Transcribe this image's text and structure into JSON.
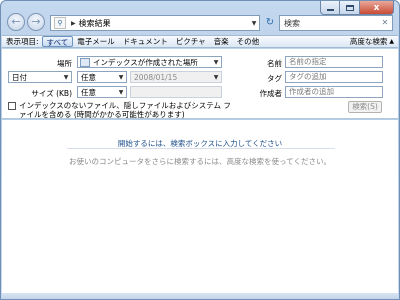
{
  "window": {
    "controls": {
      "close_glyph": "x"
    }
  },
  "nav": {
    "back_icon": "back-arrow-icon",
    "forward_icon": "forward-arrow-icon",
    "address": {
      "path": "検索結果"
    },
    "search": {
      "placeholder": "検索"
    }
  },
  "filterbar": {
    "label": "表示項目:",
    "items": [
      {
        "label": "すべて",
        "active": true
      },
      {
        "label": "電子メール",
        "active": false
      },
      {
        "label": "ドキュメント",
        "active": false
      },
      {
        "label": "ピクチャ",
        "active": false
      },
      {
        "label": "音楽",
        "active": false
      },
      {
        "label": "その他",
        "active": false
      }
    ],
    "advanced_label": "高度な検索"
  },
  "advanced": {
    "location_label": "場所",
    "location_value": "インデックスが作成された場所",
    "date_field": "日付",
    "date_operator": "任意",
    "date_value": "2008/01/15",
    "size_label": "サイズ (KB)",
    "size_operator": "任意",
    "name_label": "名前",
    "name_placeholder": "名前の指定",
    "tag_label": "タグ",
    "tag_placeholder": "タグの追加",
    "author_label": "作成者",
    "author_placeholder": "作成者の追加",
    "checkbox_label": "インデックスのないファイル、隠しファイルおよびシステム ファイルを含める (時間がかかる可能性があります)",
    "search_button": "検索(S)"
  },
  "main": {
    "start_link": "開始するには、検索ボックスに入力してください",
    "hint": "お使いのコンピュータをさらに検索するには、高度な検索を使ってください。"
  }
}
